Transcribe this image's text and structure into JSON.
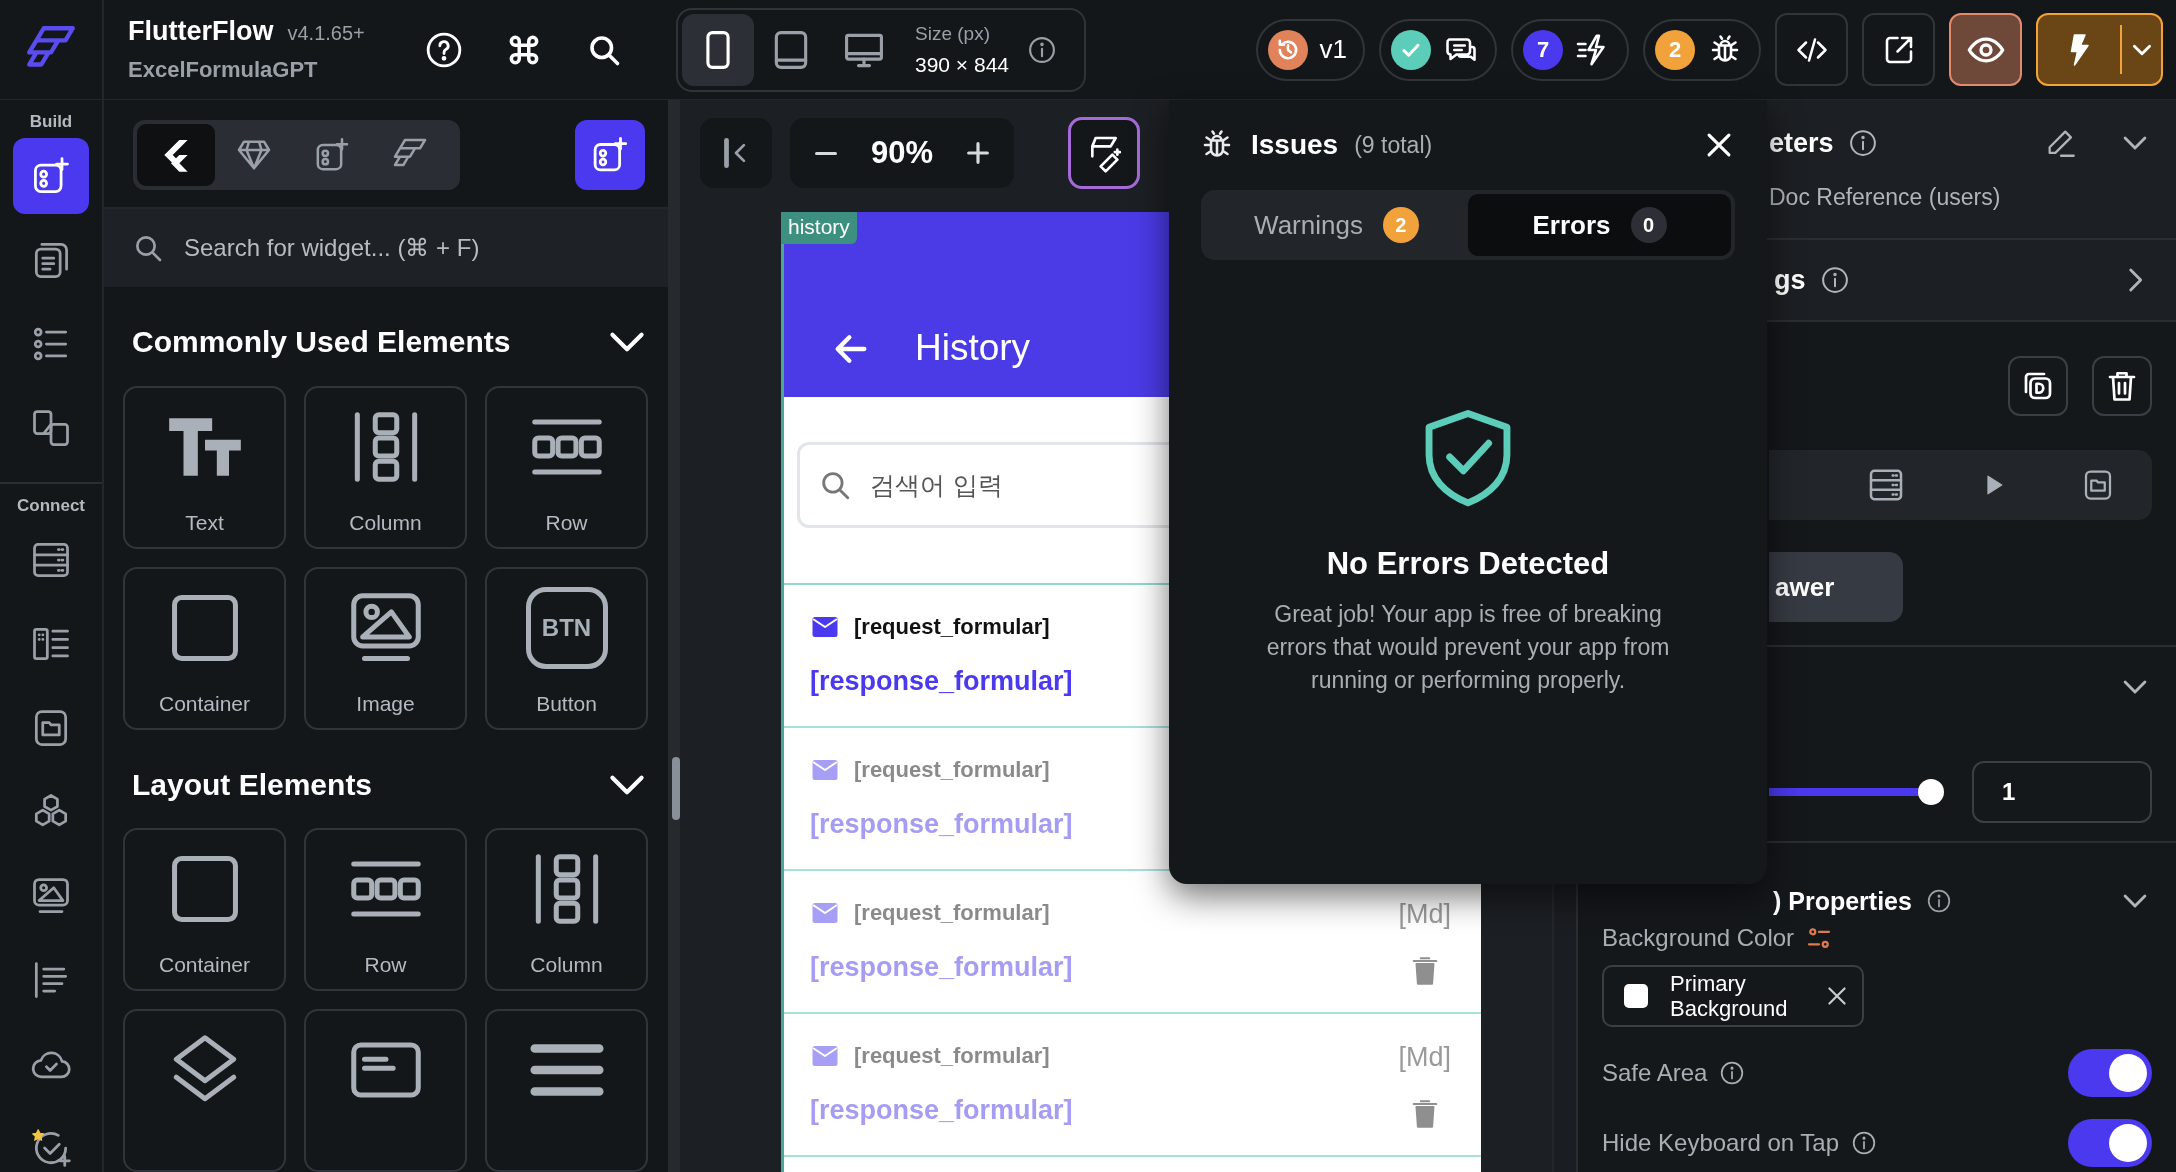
{
  "topbar": {
    "app_name": "FlutterFlow",
    "version": "v4.1.65+",
    "project": "ExcelFormulaGPT",
    "devices": [
      {
        "kind": "phone",
        "selected": true
      },
      {
        "kind": "tablet",
        "selected": false
      },
      {
        "kind": "desktop",
        "selected": false
      }
    ],
    "size_label": "Size (px)",
    "size_value": "390 × 844",
    "pills": [
      {
        "kind": "version",
        "label": "v1"
      },
      {
        "kind": "comments"
      },
      {
        "kind": "actions",
        "count": "7"
      },
      {
        "kind": "issues",
        "count": "2"
      }
    ]
  },
  "rail": {
    "sections": [
      {
        "label": "Build",
        "items": [
          {
            "kind": "widgets",
            "selected": true
          },
          {
            "kind": "pages",
            "selected": false
          },
          {
            "kind": "tree",
            "selected": false
          },
          {
            "kind": "components",
            "selected": false
          }
        ]
      },
      {
        "label": "Connect",
        "items": [
          {
            "kind": "database",
            "selected": false
          },
          {
            "kind": "list-detail",
            "selected": false
          },
          {
            "kind": "media",
            "selected": false
          },
          {
            "kind": "api",
            "selected": false
          },
          {
            "kind": "images",
            "selected": false
          },
          {
            "kind": "text",
            "selected": false
          },
          {
            "kind": "cloud",
            "selected": false
          },
          {
            "kind": "badge",
            "selected": false
          }
        ]
      }
    ]
  },
  "widget_panel": {
    "tabs": [
      {
        "kind": "flutter",
        "selected": true
      },
      {
        "kind": "gem",
        "selected": false
      },
      {
        "kind": "widgets",
        "selected": false
      },
      {
        "kind": "logo",
        "selected": false
      }
    ],
    "search": {
      "placeholder": "Search for widget... (⌘ + F)"
    },
    "sections": [
      {
        "title": "Commonly Used Elements",
        "expanded": true,
        "items": [
          {
            "kind": "text",
            "label": "Text"
          },
          {
            "kind": "column",
            "label": "Column"
          },
          {
            "kind": "row",
            "label": "Row"
          },
          {
            "kind": "container",
            "label": "Container"
          },
          {
            "kind": "image",
            "label": "Image"
          },
          {
            "kind": "button",
            "label": "Button",
            "icon_text": "BTN"
          }
        ]
      },
      {
        "title": "Layout Elements",
        "expanded": true,
        "items": [
          {
            "kind": "container",
            "label": "Container"
          },
          {
            "kind": "row",
            "label": "Row"
          },
          {
            "kind": "column",
            "label": "Column"
          },
          {
            "kind": "stack"
          },
          {
            "kind": "card"
          },
          {
            "kind": "listview"
          }
        ]
      }
    ]
  },
  "canvas": {
    "zoom": "90%",
    "page": {
      "tag": "history",
      "title": "History",
      "search": {
        "placeholder": "검색어 입력"
      },
      "rows": [
        {
          "request": "[request_formular]",
          "response": "[response_formular]",
          "dimmed": false
        },
        {
          "request": "[request_formular]",
          "response": "[response_formular]",
          "dimmed": true
        },
        {
          "request": "[request_formular]",
          "response": "[response_formular]",
          "dimmed": true,
          "date": "[Md]"
        },
        {
          "request": "[request_formular]",
          "response": "[response_formular]",
          "dimmed": true,
          "date": "[Md]"
        }
      ]
    }
  },
  "issues": {
    "title": "Issues",
    "total": "(9 total)",
    "tabs": [
      {
        "label": "Warnings",
        "count": "2",
        "selected": false
      },
      {
        "label": "Errors",
        "count": "0",
        "selected": true
      }
    ],
    "empty_title": "No Errors Detected",
    "empty_text": "Great job! Your app is free of breaking errors that would prevent your app from running or performing properly."
  },
  "properties": {
    "params_title": "eters",
    "params_expanded": true,
    "doc_reference": "Doc Reference (users)",
    "settings_title": "gs",
    "settings_expanded": false,
    "drawer_button": "awer",
    "section_expanded": true,
    "slider": {
      "level": 1,
      "value": "1"
    },
    "page_properties": {
      "title": ") Properties",
      "expanded": true,
      "background_color_label": "Background Color",
      "background_color": "Primary Background",
      "toggles": [
        {
          "label": "Safe Area",
          "on": true
        },
        {
          "label": "Hide Keyboard on Tap",
          "on": true
        }
      ]
    }
  }
}
